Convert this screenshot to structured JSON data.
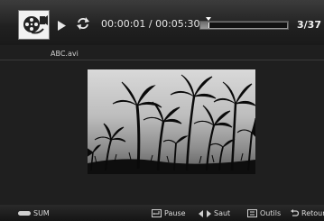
{
  "player": {
    "time_display": "00:00:01 / 00:05:30",
    "progress_fraction": 0.003,
    "counter": "3/37",
    "filename": "ABC.avi"
  },
  "icons": {
    "media": "film-reel-icon",
    "play": "play-icon",
    "repeat": "repeat-icon"
  },
  "footer": {
    "sum_label": "SUM",
    "pause_label": "Pause",
    "saut_label": "Saut",
    "outils_label": "Outils",
    "retour_label": "Retour"
  },
  "colors": {
    "background": "#1f1f1f",
    "text": "#d8d8d8"
  }
}
